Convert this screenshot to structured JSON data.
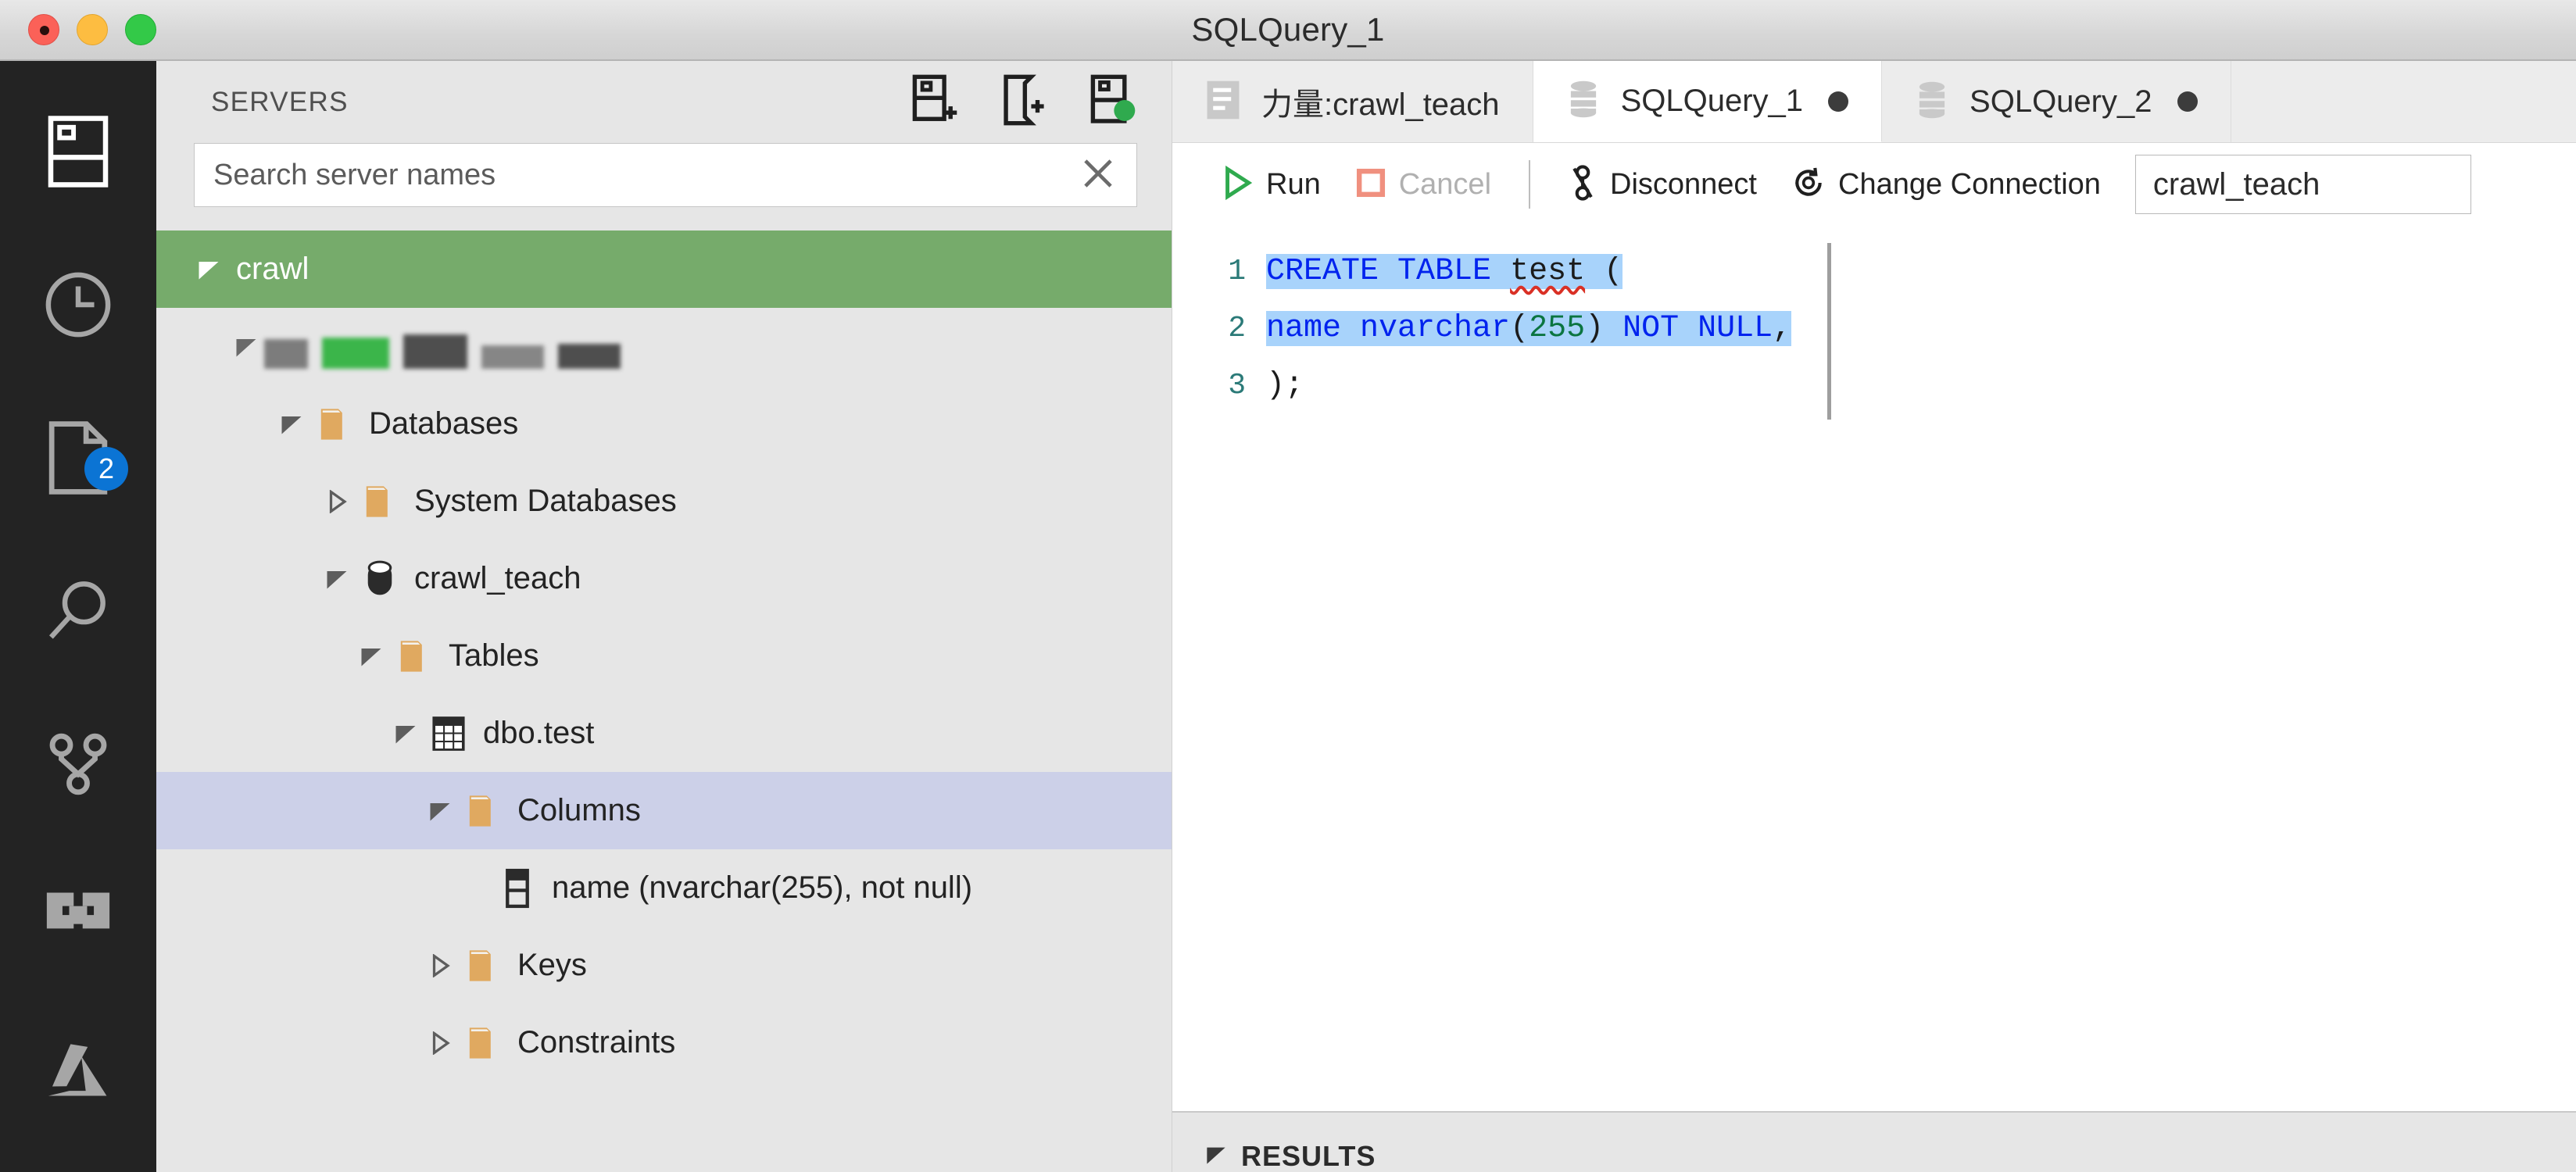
{
  "window": {
    "title": "SQLQuery_1",
    "controls": {
      "close": "close",
      "minimize": "minimize",
      "maximize": "maximize"
    }
  },
  "activity_bar": {
    "items": [
      {
        "name": "servers",
        "icon": "servers-icon",
        "active": true,
        "badge": ""
      },
      {
        "name": "history",
        "icon": "clock-icon",
        "active": false,
        "badge": ""
      },
      {
        "name": "open-editors",
        "icon": "file-icon",
        "active": false,
        "badge": "2"
      },
      {
        "name": "search",
        "icon": "search-icon",
        "active": false,
        "badge": ""
      },
      {
        "name": "source-control",
        "icon": "source-control-icon",
        "active": false,
        "badge": ""
      },
      {
        "name": "extensions",
        "icon": "extensions-icon",
        "active": false,
        "badge": ""
      },
      {
        "name": "azure",
        "icon": "azure-icon",
        "active": false,
        "badge": ""
      }
    ]
  },
  "sidebar": {
    "title": "SERVERS",
    "actions": [
      {
        "name": "new-connection",
        "icon": "new-connection-icon"
      },
      {
        "name": "new-connection-group",
        "icon": "new-server-group-icon"
      },
      {
        "name": "refresh-servers",
        "icon": "server-connected-icon"
      }
    ],
    "search": {
      "placeholder": "Search server names",
      "value": "",
      "clear_icon": "close-icon"
    },
    "tree": [
      {
        "label": "crawl",
        "icon": "chevron-down-icon",
        "indent": 0,
        "state": "expanded",
        "kind": "group",
        "selected_server": true
      },
      {
        "label": "",
        "icon": "server-icon",
        "indent": 1,
        "state": "expanded",
        "kind": "server",
        "redacted": true
      },
      {
        "label": "Databases",
        "icon": "folder-icon",
        "indent": 2,
        "state": "expanded",
        "kind": "folder"
      },
      {
        "label": "System Databases",
        "icon": "folder-icon",
        "indent": 3,
        "state": "collapsed",
        "kind": "folder"
      },
      {
        "label": "crawl_teach",
        "icon": "database-icon",
        "indent": 3,
        "state": "expanded",
        "kind": "database"
      },
      {
        "label": "Tables",
        "icon": "folder-icon",
        "indent": 4,
        "state": "expanded",
        "kind": "folder"
      },
      {
        "label": "dbo.test",
        "icon": "table-icon",
        "indent": 5,
        "state": "expanded",
        "kind": "table"
      },
      {
        "label": "Columns",
        "icon": "folder-icon",
        "indent": 6,
        "state": "expanded",
        "kind": "folder",
        "selected": true
      },
      {
        "label": "name (nvarchar(255), not null)",
        "icon": "column-icon",
        "indent": 7,
        "state": "leaf",
        "kind": "column"
      },
      {
        "label": "Keys",
        "icon": "folder-icon",
        "indent": 6,
        "state": "collapsed",
        "kind": "folder"
      },
      {
        "label": "Constraints",
        "icon": "folder-icon",
        "indent": 6,
        "state": "collapsed",
        "kind": "folder"
      }
    ]
  },
  "tabs": [
    {
      "label": "力量:crawl_teach",
      "icon": "script-icon",
      "active": false,
      "dirty": false
    },
    {
      "label": "SQLQuery_1",
      "icon": "database-icon",
      "active": true,
      "dirty": true
    },
    {
      "label": "SQLQuery_2",
      "icon": "database-icon",
      "active": false,
      "dirty": true
    }
  ],
  "toolbar": {
    "run_label": "Run",
    "run_icon": "play-icon",
    "cancel_label": "Cancel",
    "cancel_icon": "stop-icon",
    "cancel_disabled": true,
    "disconnect_label": "Disconnect",
    "disconnect_icon": "disconnect-icon",
    "change_connection_label": "Change Connection",
    "change_connection_icon": "change-connection-icon",
    "database_selected": "crawl_teach"
  },
  "editor": {
    "lines": [
      {
        "no": "1",
        "text": "CREATE TABLE test ("
      },
      {
        "no": "2",
        "text": "  name nvarchar(255) NOT NULL,"
      },
      {
        "no": "3",
        "text": ");"
      }
    ],
    "line_numbers": [
      "1",
      "2",
      "3"
    ],
    "tokens": {
      "l1_kw": "CREATE TABLE",
      "l1_ident": "test",
      "l1_paren": " (",
      "l2_ident": "name nvarchar",
      "l2_open": "(",
      "l2_num": "255",
      "l2_close": ") ",
      "l2_kw": "NOT NULL",
      "l2_comma": ",",
      "l3": ");"
    }
  },
  "results": {
    "label": "RESULTS",
    "twisty": "chevron-down-icon"
  },
  "colors": {
    "accent_blue": "#0b74d4",
    "selected_server_green": "#76ab6b",
    "tree_selection": "#ccd0e8",
    "folder_orange": "#e0a960",
    "keyword_blue": "#0023ee",
    "number_green": "#0b7541",
    "selection_blue": "#a8d3fb",
    "error_red": "#d93025",
    "run_green": "#2faa4e",
    "cancel_salmon": "#f0907f"
  }
}
